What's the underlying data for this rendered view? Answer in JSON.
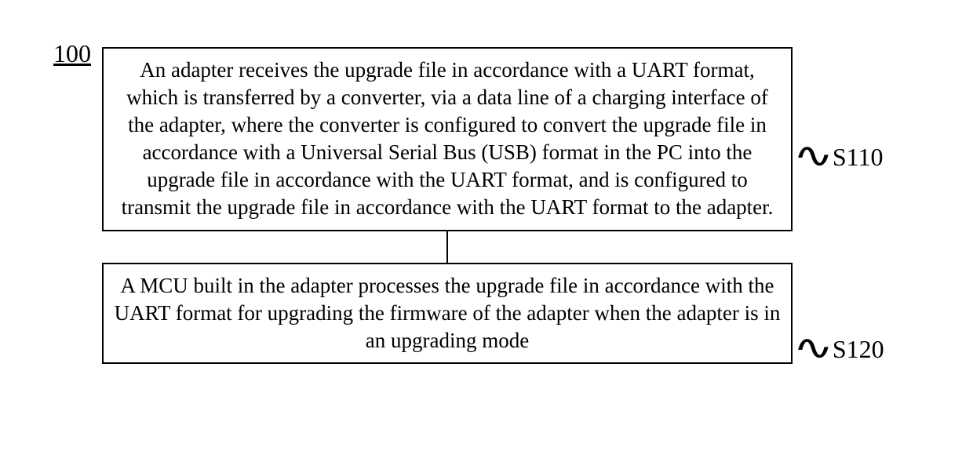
{
  "figure_label": "100",
  "steps": {
    "s110": {
      "label": "S110",
      "text": "An adapter receives the upgrade file in accordance with a UART format, which is transferred by a converter, via a data line of a charging interface of the adapter, where the converter is configured to convert the upgrade file in accordance with a Universal Serial Bus (USB) format in the PC into the upgrade file in accordance with the UART format, and is configured to transmit the upgrade file in accordance with the UART format to the adapter."
    },
    "s120": {
      "label": "S120",
      "text": "A MCU built in the adapter processes the upgrade file in accordance with the UART format for upgrading the firmware of the adapter when the adapter is in an upgrading mode"
    }
  }
}
